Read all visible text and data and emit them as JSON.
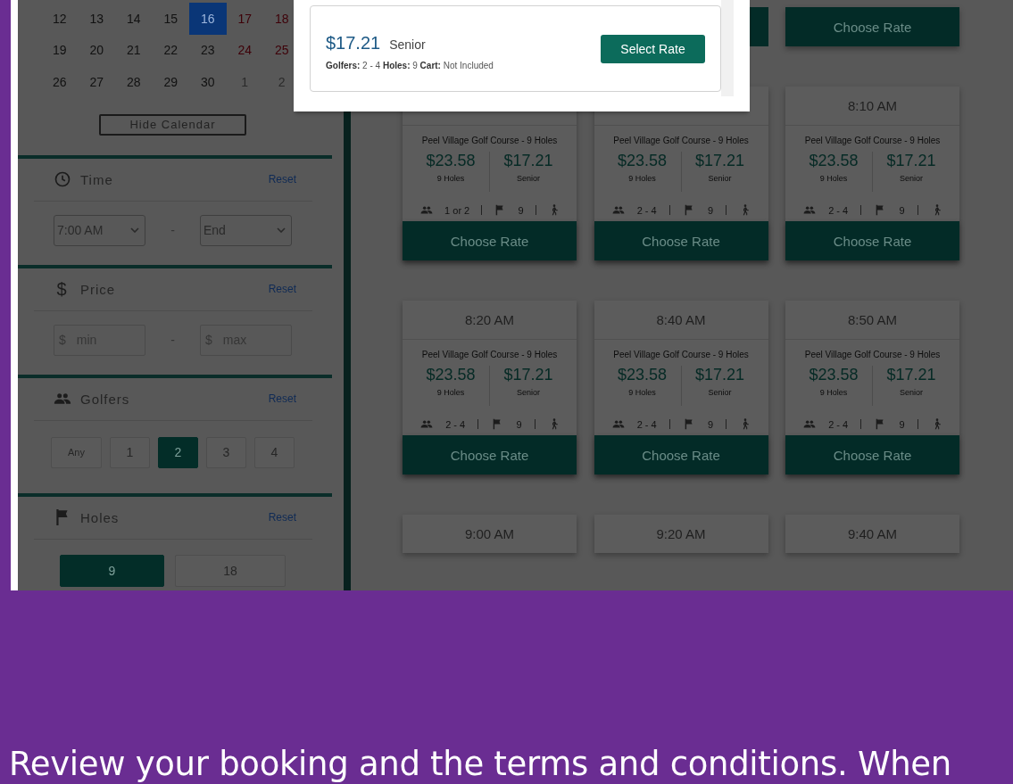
{
  "calendar": {
    "weeks": [
      [
        {
          "day": "12",
          "kind": "weekday",
          "selected": false
        },
        {
          "day": "13",
          "kind": "weekday",
          "selected": false
        },
        {
          "day": "14",
          "kind": "weekday",
          "selected": false
        },
        {
          "day": "15",
          "kind": "weekday",
          "selected": false
        },
        {
          "day": "16",
          "kind": "weekday",
          "selected": true
        },
        {
          "day": "17",
          "kind": "weekend",
          "selected": false
        },
        {
          "day": "18",
          "kind": "weekend",
          "selected": false
        }
      ],
      [
        {
          "day": "19",
          "kind": "weekday",
          "selected": false
        },
        {
          "day": "20",
          "kind": "weekday",
          "selected": false
        },
        {
          "day": "21",
          "kind": "weekday",
          "selected": false
        },
        {
          "day": "22",
          "kind": "weekday",
          "selected": false
        },
        {
          "day": "23",
          "kind": "weekday",
          "selected": false
        },
        {
          "day": "24",
          "kind": "weekend",
          "selected": false
        },
        {
          "day": "25",
          "kind": "weekend",
          "selected": false
        }
      ],
      [
        {
          "day": "26",
          "kind": "weekday",
          "selected": false
        },
        {
          "day": "27",
          "kind": "weekday",
          "selected": false
        },
        {
          "day": "28",
          "kind": "weekday",
          "selected": false
        },
        {
          "day": "29",
          "kind": "weekday",
          "selected": false
        },
        {
          "day": "30",
          "kind": "weekday",
          "selected": false
        },
        {
          "day": "1",
          "kind": "other_month",
          "selected": false
        },
        {
          "day": "2",
          "kind": "other_month",
          "selected": false
        }
      ]
    ],
    "hide_button": "Hide Calendar"
  },
  "filters": [
    {
      "kind": "select",
      "title": "Time",
      "reset": "Reset",
      "from": "7:00 AM",
      "separator": "-",
      "to": "End"
    },
    {
      "kind": "range",
      "title": "Price",
      "icon_glyph": "$",
      "reset": "Reset",
      "min_prefix": "$",
      "min_placeholder": "min",
      "separator": "-",
      "max_prefix": "$",
      "max_placeholder": "max"
    },
    {
      "kind": "chips",
      "title": "Golfers",
      "reset": "Reset",
      "options": [
        {
          "label": "Any",
          "selected": false
        },
        {
          "label": "1",
          "selected": false
        },
        {
          "label": "2",
          "selected": true
        },
        {
          "label": "3",
          "selected": false
        },
        {
          "label": "4",
          "selected": false
        }
      ]
    },
    {
      "kind": "toggle",
      "title": "Holes",
      "reset": "Reset",
      "options": [
        {
          "label": "9",
          "selected": true
        },
        {
          "label": "18",
          "selected": false
        }
      ]
    }
  ],
  "tee_times": [
    {
      "cards": [
        {
          "kind": "hidden"
        },
        {
          "kind": "edge"
        },
        {
          "kind": "button_only",
          "button": "Choose Rate"
        }
      ]
    },
    {
      "cards": [
        {
          "kind": "full",
          "course": "Peel Village Golf Course - 9 Holes",
          "prices": [
            {
              "amount": "$23.58",
              "label": "9 Holes"
            },
            {
              "amount": "$17.21",
              "label": "Senior"
            }
          ],
          "golfers": "1 or 2",
          "holes": "9",
          "button": "Choose Rate"
        },
        {
          "kind": "full",
          "course": "Peel Village Golf Course - 9 Holes",
          "prices": [
            {
              "amount": "$23.58",
              "label": "9 Holes"
            },
            {
              "amount": "$17.21",
              "label": "Senior"
            }
          ],
          "golfers": "2 - 4",
          "holes": "9",
          "button": "Choose Rate"
        },
        {
          "kind": "full",
          "time": "8:10 AM",
          "course": "Peel Village Golf Course - 9 Holes",
          "prices": [
            {
              "amount": "$23.58",
              "label": "9 Holes"
            },
            {
              "amount": "$17.21",
              "label": "Senior"
            }
          ],
          "golfers": "2 - 4",
          "holes": "9",
          "button": "Choose Rate"
        }
      ]
    },
    {
      "cards": [
        {
          "kind": "full",
          "time": "8:20 AM",
          "course": "Peel Village Golf Course - 9 Holes",
          "prices": [
            {
              "amount": "$23.58",
              "label": "9 Holes"
            },
            {
              "amount": "$17.21",
              "label": "Senior"
            }
          ],
          "golfers": "2 - 4",
          "holes": "9",
          "button": "Choose Rate"
        },
        {
          "kind": "full",
          "time": "8:40 AM",
          "course": "Peel Village Golf Course - 9 Holes",
          "prices": [
            {
              "amount": "$23.58",
              "label": "9 Holes"
            },
            {
              "amount": "$17.21",
              "label": "Senior"
            }
          ],
          "golfers": "2 - 4",
          "holes": "9",
          "button": "Choose Rate"
        },
        {
          "kind": "full",
          "time": "8:50 AM",
          "course": "Peel Village Golf Course - 9 Holes",
          "prices": [
            {
              "amount": "$23.58",
              "label": "9 Holes"
            },
            {
              "amount": "$17.21",
              "label": "Senior"
            }
          ],
          "golfers": "2 - 4",
          "holes": "9",
          "button": "Choose Rate"
        }
      ]
    },
    {
      "cards": [
        {
          "kind": "top",
          "time": "9:00 AM"
        },
        {
          "kind": "top",
          "time": "9:20 AM"
        },
        {
          "kind": "top",
          "time": "9:40 AM"
        }
      ]
    }
  ],
  "rate_popup": {
    "price": "$17.21",
    "rate": "Senior",
    "details": "**Golfers:** 2 - 4 **Holes:** 9 **Cart:** Not Included",
    "button": "Select Rate"
  },
  "caption": "Review your booking and the terms and conditions. When"
}
